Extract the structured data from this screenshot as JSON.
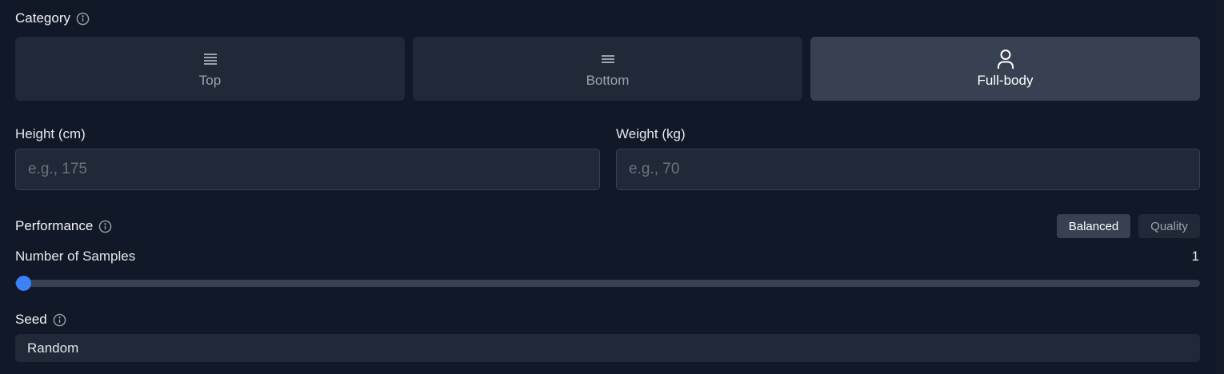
{
  "category": {
    "label": "Category",
    "info_icon": "info-icon",
    "options": [
      {
        "label": "Top",
        "icon": "top-garment-icon",
        "active": false
      },
      {
        "label": "Bottom",
        "icon": "bottom-garment-icon",
        "active": false
      },
      {
        "label": "Full-body",
        "icon": "person-icon",
        "active": true
      }
    ]
  },
  "height": {
    "label": "Height (cm)",
    "placeholder": "e.g., 175",
    "value": ""
  },
  "weight": {
    "label": "Weight (kg)",
    "placeholder": "e.g., 70",
    "value": ""
  },
  "performance": {
    "label": "Performance",
    "info_icon": "info-icon",
    "options": [
      {
        "label": "Balanced",
        "active": true
      },
      {
        "label": "Quality",
        "active": false
      }
    ]
  },
  "samples": {
    "label": "Number of Samples",
    "value": "1",
    "slider_fraction": 0
  },
  "seed": {
    "label": "Seed",
    "info_icon": "info-icon",
    "value": "Random"
  },
  "colors": {
    "background": "#111827",
    "panel": "#1f2937",
    "active_panel": "#374151",
    "accent": "#3b82f6"
  }
}
